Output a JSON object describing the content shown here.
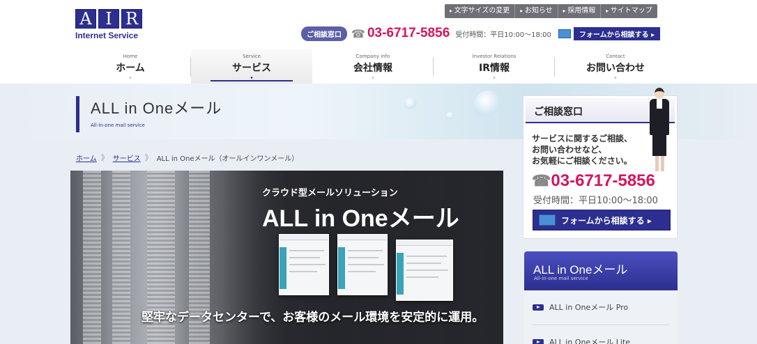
{
  "header": {
    "logo": {
      "letters": [
        "A",
        "I",
        "R"
      ],
      "subtitle": "Internet Service"
    },
    "utility_links": [
      "文字サイズの変更",
      "お知らせ",
      "採用情報",
      "サイトマップ"
    ],
    "contact": {
      "badge": "ご相談窓口",
      "phone": "03-6717-5856",
      "hours": "受付時間：平日10:00～18:00",
      "form_button": "フォームから相談する ▸"
    }
  },
  "global_nav": [
    {
      "en": "Home",
      "jp": "ホーム"
    },
    {
      "en": "Service",
      "jp": "サービス",
      "active": true
    },
    {
      "en": "Company info",
      "jp": "会社情報"
    },
    {
      "en": "Investor Relations",
      "jp": "IR情報"
    },
    {
      "en": "Contact",
      "jp": "お問い合わせ"
    }
  ],
  "page": {
    "title": "ALL in Oneメール",
    "subtitle": "All-in-one mail service"
  },
  "breadcrumb": {
    "home": "ホーム",
    "service": "サービス",
    "current": "ALL in Oneメール（オールインワンメール）",
    "separator": "》"
  },
  "hero": {
    "category": "クラウド型メールソリューション",
    "title": "ALL in Oneメール",
    "caption": "堅牢なデータセンターで、お客様のメール環境を安定的に運用。"
  },
  "consult_box": {
    "heading": "ご相談窓口",
    "lines": [
      "サービスに関するご相談、",
      "お問い合わせなど、",
      "お気軽にご相談ください。"
    ],
    "phone": "03-6717-5856",
    "hours": "受付時間：平日10:00～18:00",
    "button": "フォームから相談する ▸"
  },
  "product_menu": {
    "title": "ALL in Oneメール",
    "subtitle": "All-in-one mail service",
    "items": [
      "ALL in Oneメール Pro",
      "ALL in Oneメール Lite"
    ]
  },
  "colors": {
    "brand": "#2c2f8f",
    "accent_phone": "#d6145f"
  }
}
